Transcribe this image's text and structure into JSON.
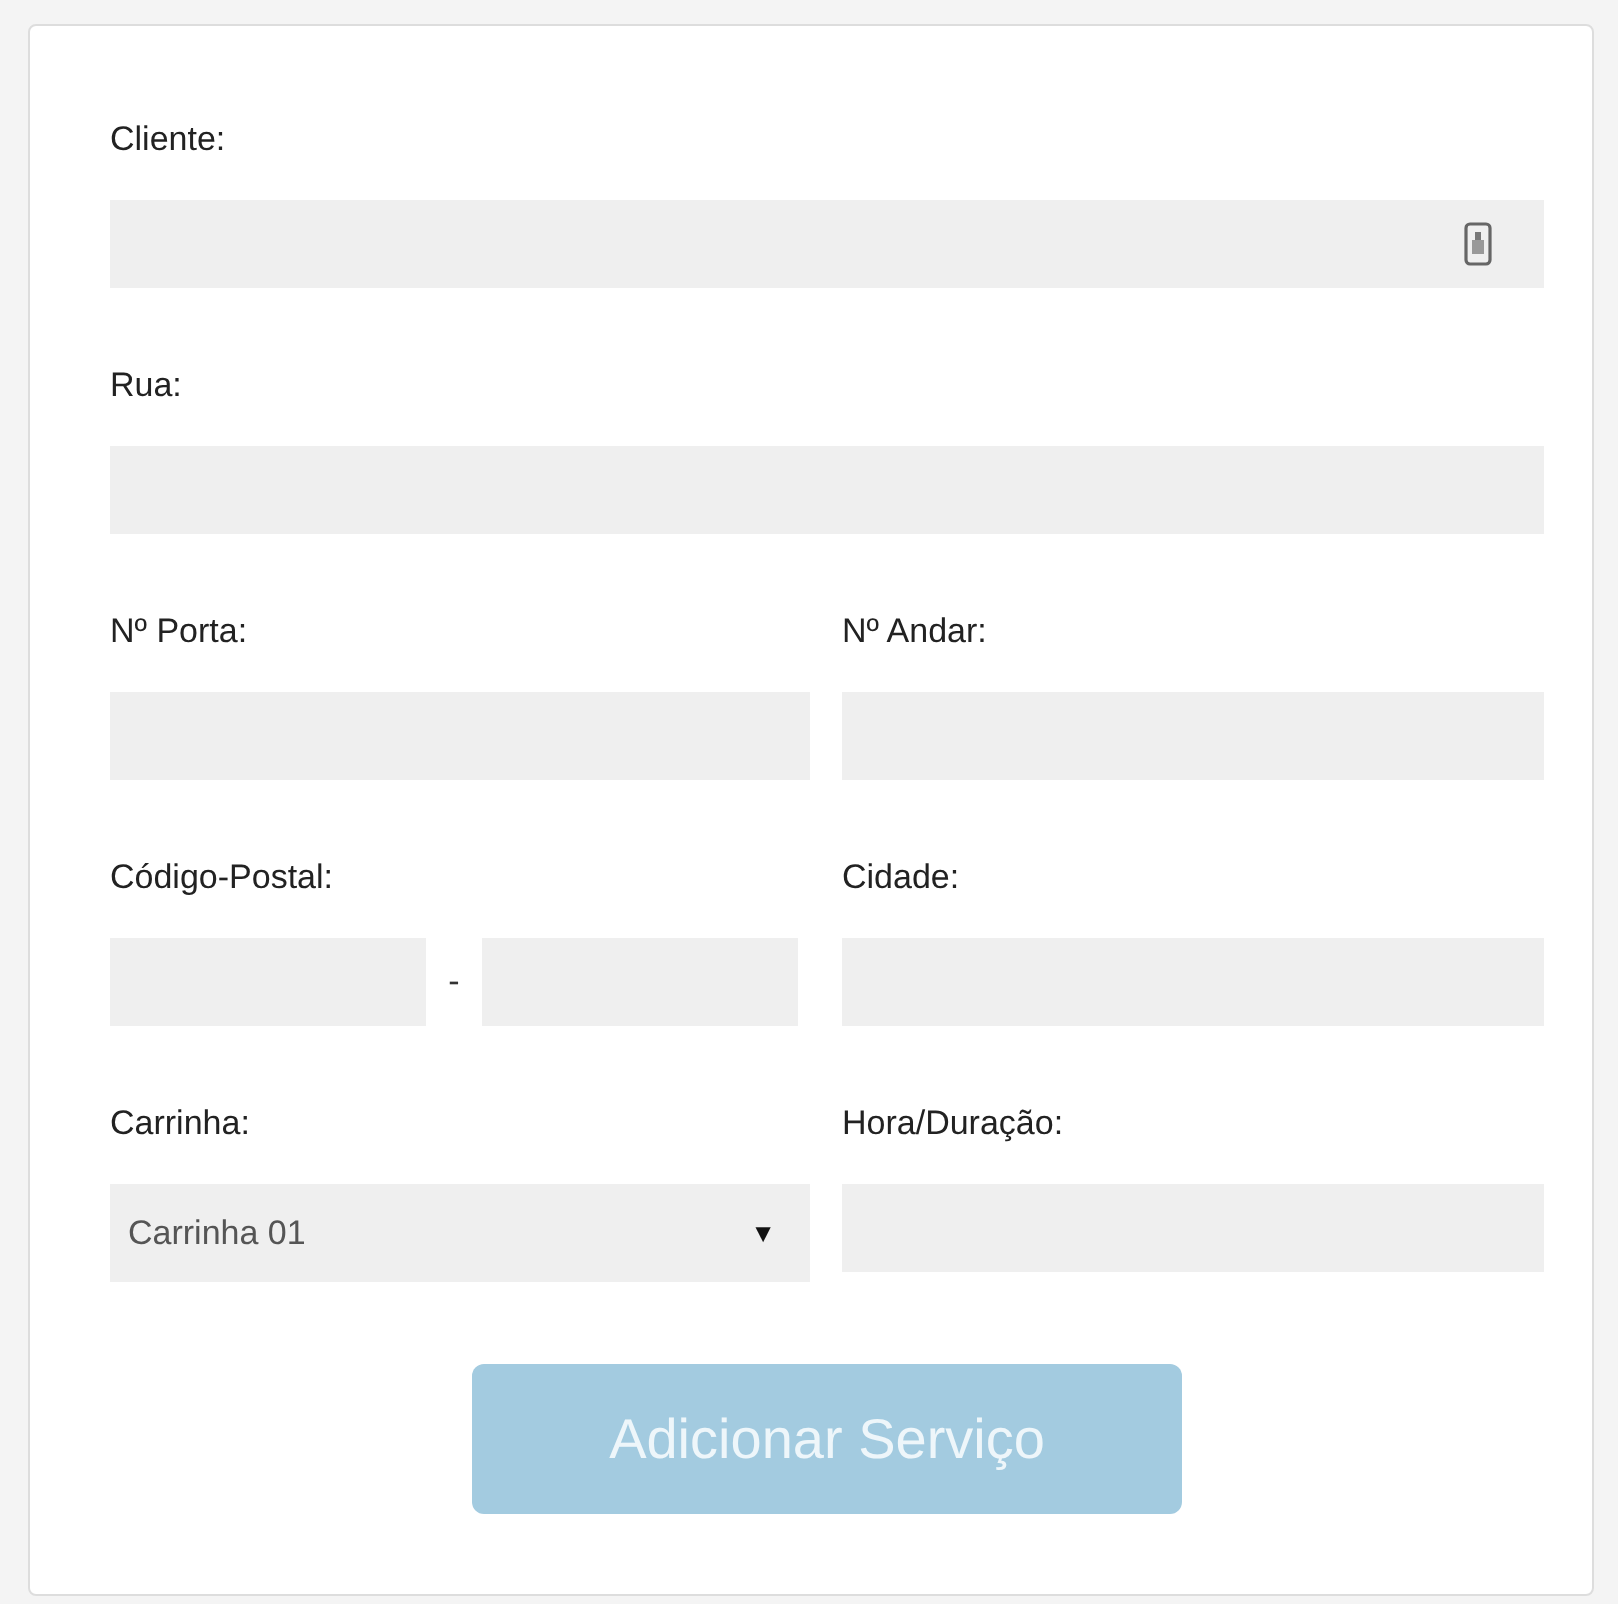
{
  "fields": [
    {
      "label": "Cliente:",
      "kind": "lookup"
    },
    {
      "label": "Rua:",
      "kind": "text"
    },
    {
      "label": "Nº Porta:",
      "kind": "text"
    },
    {
      "label": "Nº Andar:",
      "kind": "text"
    },
    {
      "label": "Código-Postal:",
      "kind": "postal",
      "separator": "-"
    },
    {
      "label": "Cidade:",
      "kind": "text"
    },
    {
      "label": "Carrinha:",
      "kind": "select",
      "value": "Carrinha 01",
      "arrow": "▼"
    },
    {
      "label": "Hora/Duração:",
      "kind": "text"
    }
  ],
  "submit": {
    "label": "Adicionar Serviço",
    "disabled": true
  }
}
